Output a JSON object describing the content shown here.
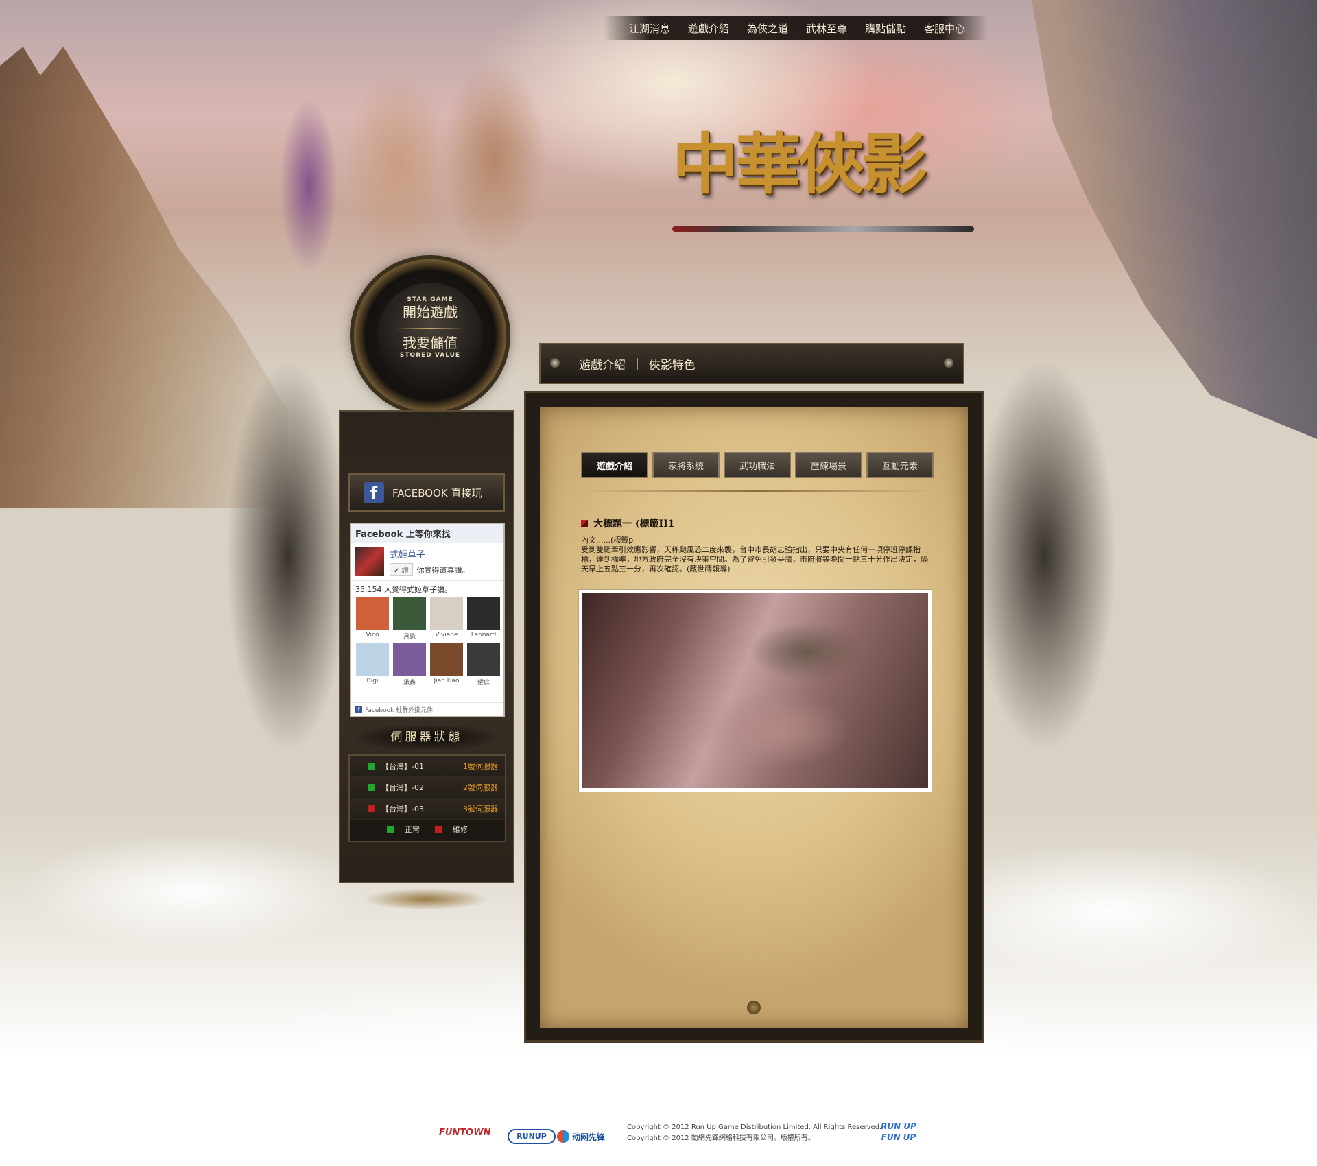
{
  "topnav": {
    "items": [
      "江湖消息",
      "遊戲介紹",
      "為俠之道",
      "武林至尊",
      "購點儲點",
      "客服中心"
    ]
  },
  "logo": {
    "title": "中華俠影"
  },
  "medallion": {
    "start_en": "STAR GAME",
    "start_zh": "開始遊戲",
    "store_zh": "我要儲值",
    "store_en": "STORED VALUE"
  },
  "sidebar": {
    "facebook_play": {
      "label": "FACEBOOK 直接玩",
      "icon": "facebook-icon"
    },
    "fb_widget": {
      "header": "Facebook 上等你來找",
      "page_name": "式姬草子",
      "like_button": "讚",
      "like_text": "你覺得這真讚。",
      "count_text": "35,154 人覺得式姬草子讚。",
      "friends": [
        {
          "name": "Vico",
          "color": "#d0603a"
        },
        {
          "name": "月詠",
          "color": "#3a5a3a"
        },
        {
          "name": "Viviane",
          "color": "#d8cfc4"
        },
        {
          "name": "Leonard",
          "color": "#2b2b2b"
        },
        {
          "name": "Bigi",
          "color": "#bcd3e6"
        },
        {
          "name": "承鑫",
          "color": "#7b5c9a"
        },
        {
          "name": "Jian Hao",
          "color": "#7a4a2a"
        },
        {
          "name": "耀庭",
          "color": "#3a3a3a"
        }
      ],
      "footer": "Facebook 社群外掛元件"
    },
    "server_title": "伺服器狀態",
    "servers": [
      {
        "name": "【台灣】-01",
        "state": "1號伺服器",
        "status_color": "#1fa82e"
      },
      {
        "name": "【台灣】-02",
        "state": "2號伺服器",
        "status_color": "#1fa82e"
      },
      {
        "name": "【台灣】-03",
        "state": "3號伺服器",
        "status_color": "#c02020"
      }
    ],
    "legend": [
      {
        "label": "正常",
        "color": "#1fa82e"
      },
      {
        "label": "維修",
        "color": "#c02020"
      }
    ]
  },
  "section": {
    "title": "遊戲介紹",
    "subtitle": "俠影特色"
  },
  "tabs": [
    {
      "label": "遊戲介紹",
      "active": true
    },
    {
      "label": "家將系統",
      "active": false
    },
    {
      "label": "武功職法",
      "active": false
    },
    {
      "label": "歷練場景",
      "active": false
    },
    {
      "label": "互動元素",
      "active": false
    }
  ],
  "article": {
    "h1": "大標題一 (標籤H1",
    "tag_line": "內文......(標籤p",
    "body": "受到雙颱牽引效應影響，天秤颱風恐二度來襲，台中市長胡志強指出，只要中央有任何一項停班停課指標，達到標準，地方政府完全沒有決策空間。為了避免引發爭議，市府將等晚間十點三十分作出決定，隔天早上五點三十分，再次確認。(蔵世蒔報導)"
  },
  "footer": {
    "logo1": "FUNTOWN",
    "logo2": "RUNUP",
    "logo3": "动网先锋",
    "copyright_en": "Copyright © 2012 Run Up Game Distribution Limited. All Rights Reserved.",
    "copyright_zh": "Copyright © 2012 動網先鋒網絡科技有限公司。版權所有。",
    "logo4_line1": "RUN UP",
    "logo4_line2": "FUN UP"
  }
}
